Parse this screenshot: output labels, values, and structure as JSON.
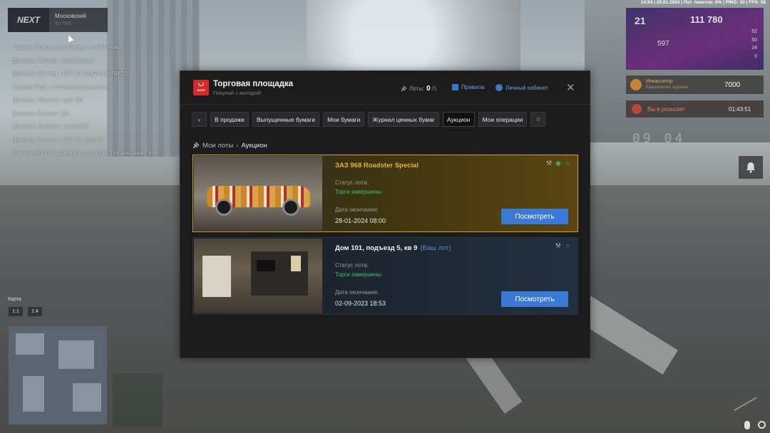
{
  "server": {
    "logo": "NEXT",
    "name": "Московский",
    "sub": "ID: 000"
  },
  "chat": [
    "Сашка: Пришел на ферму на Rublevka",
    "Даниэль Паттон: такой клан?",
    "Даниэль Паттон: ЗАП 26 ЗАБРАНИЛИ 20",
    "Сашка: Paul: в Marketplace завозно",
    "Даниэль Лежнин: щас 20",
    "Даниэль Паттон: ДА",
    "Даниэль Лежнин: со мной?",
    "Даниэль Паттон: ЧТО ЗА КЛАН?",
    "Санчоус Келли: Даниэль едь к пос грк расскажу все"
  ],
  "topbar": "14:54 | 29.01.2024 | Пот. пакетов: 0% | PING: 33 | FPS: 58",
  "stats": {
    "level": "21",
    "money": "111 780",
    "armor": "597",
    "col": [
      "52",
      "50",
      "24",
      "0"
    ]
  },
  "quest": {
    "title": "Инкассатор",
    "sub": "Ежедневное задание",
    "amount": "7000"
  },
  "wanted": {
    "label": "Вы в розыске!",
    "time": "01:43:51"
  },
  "clock": "09 04",
  "map": {
    "label": "Карта",
    "zoom1": "1:1",
    "zoom2": "1:4"
  },
  "window": {
    "title": "Торговая площадка",
    "subtitle": "Покупай с выгодой!",
    "shop_icon_text": "SHOP",
    "lots_label": "Лоты:",
    "lots_count": "0",
    "lots_total": "/5",
    "rules": "Правила",
    "cabinet": "Личный кабинет",
    "close": "✕"
  },
  "tabs": [
    {
      "label": "‹"
    },
    {
      "label": "В продаже"
    },
    {
      "label": "Выпущенные бумаги"
    },
    {
      "label": "Мои бумаги"
    },
    {
      "label": "Журнал ценных бумаг"
    },
    {
      "label": "Аукцион"
    },
    {
      "label": "Мои операции"
    },
    {
      "label": "☆"
    }
  ],
  "breadcrumb": {
    "root": "Мои лоты",
    "sep": "›",
    "current": "Аукцион"
  },
  "lots": [
    {
      "name": "ЗАЗ 968 Roadster Special",
      "mine": "",
      "status_label": "Статус лота:",
      "status": "Торги завершены",
      "date_label": "Дата окончания:",
      "date": "28-01-2024 08:00",
      "button": "Посмотреть"
    },
    {
      "name": "Дом 101, подъезд 5, кв 9",
      "mine": "(Ваш лот)",
      "status_label": "Статус лота:",
      "status": "Торги завершены",
      "date_label": "Дата окончания:",
      "date": "02-09-2023 18:53",
      "button": "Посмотреть"
    }
  ],
  "colors": {
    "accent_blue": "#3a7ad6",
    "status_green": "#3cc46a",
    "gold": "#d4a52a",
    "shop_red": "#d42a2a"
  }
}
